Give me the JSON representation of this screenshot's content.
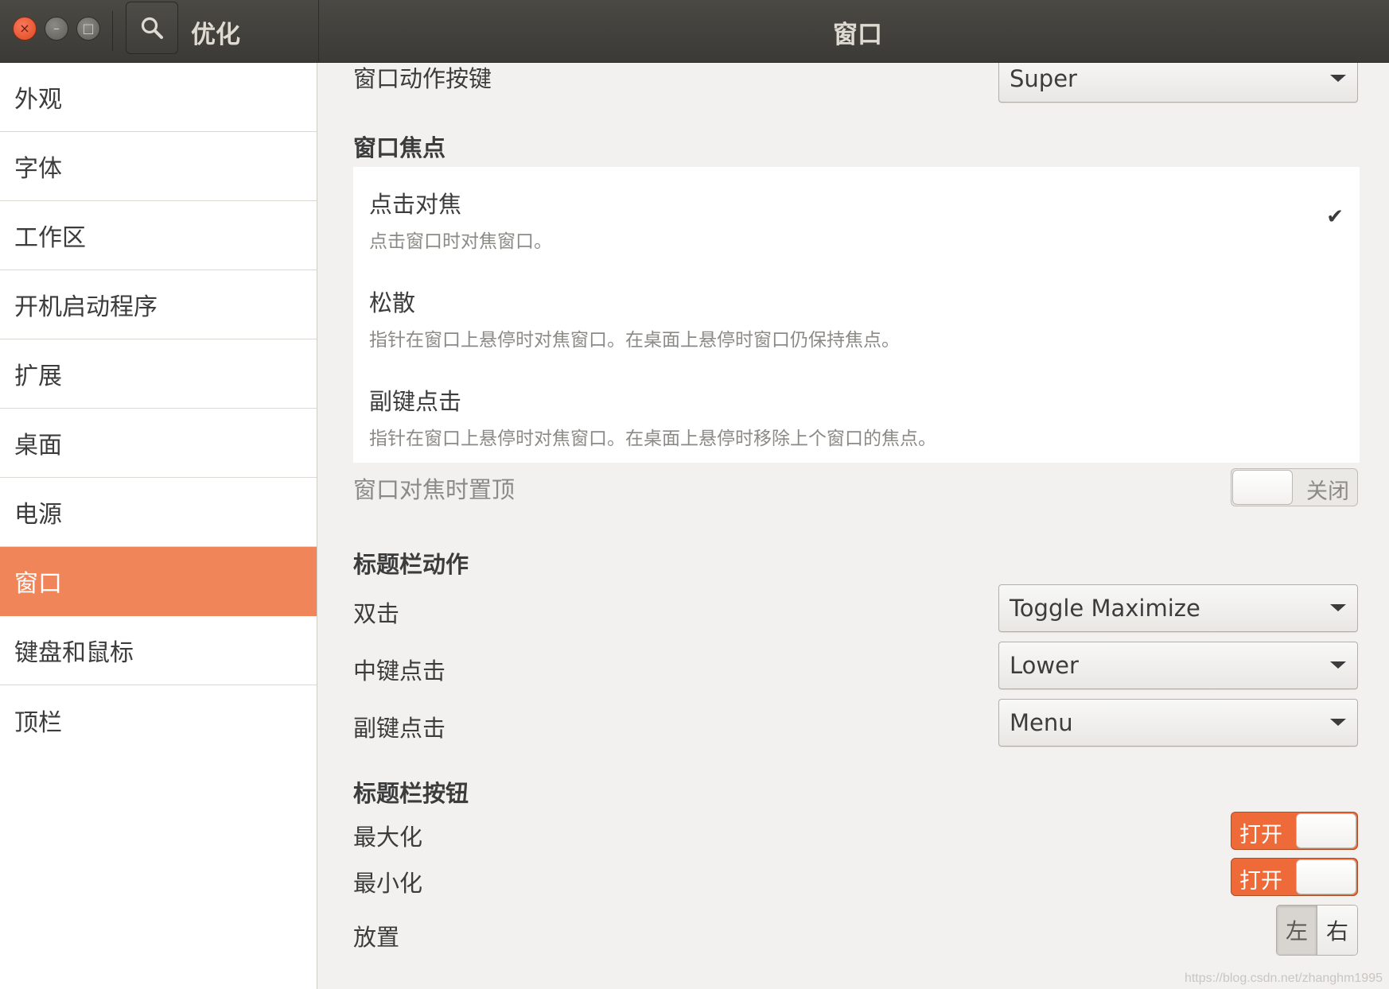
{
  "header": {
    "app_title": "优化",
    "page_title": "窗口",
    "close_glyph": "×",
    "minimize_glyph": "–",
    "maximize_glyph": "□"
  },
  "sidebar": {
    "items": [
      {
        "label": "外观",
        "active": false
      },
      {
        "label": "字体",
        "active": false
      },
      {
        "label": "工作区",
        "active": false
      },
      {
        "label": "开机启动程序",
        "active": false
      },
      {
        "label": "扩展",
        "active": false
      },
      {
        "label": "桌面",
        "active": false
      },
      {
        "label": "电源",
        "active": false
      },
      {
        "label": "窗口",
        "active": true
      },
      {
        "label": "键盘和鼠标",
        "active": false
      },
      {
        "label": "顶栏",
        "active": false
      }
    ]
  },
  "main": {
    "action_key": {
      "label": "窗口动作按键",
      "value": "Super"
    },
    "focus_section_title": "窗口焦点",
    "focus_options": [
      {
        "title": "点击对焦",
        "desc": "点击窗口时对焦窗口。",
        "checked": true
      },
      {
        "title": "松散",
        "desc": "指针在窗口上悬停时对焦窗口。在桌面上悬停时窗口仍保持焦点。",
        "checked": false
      },
      {
        "title": "副键点击",
        "desc": "指针在窗口上悬停时对焦窗口。在桌面上悬停时移除上个窗口的焦点。",
        "checked": false
      }
    ],
    "check_glyph": "✔",
    "raise_on_focus": {
      "label": "窗口对焦时置顶",
      "state": "关闭"
    },
    "titlebar_actions_title": "标题栏动作",
    "titlebar_actions": [
      {
        "label": "双击",
        "value": "Toggle Maximize"
      },
      {
        "label": "中键点击",
        "value": "Lower"
      },
      {
        "label": "副键点击",
        "value": "Menu"
      }
    ],
    "titlebar_buttons_title": "标题栏按钮",
    "maximize": {
      "label": "最大化",
      "state": "打开"
    },
    "minimize": {
      "label": "最小化",
      "state": "打开"
    },
    "placement": {
      "label": "放置",
      "options": [
        "左",
        "右"
      ],
      "selected": "左"
    }
  },
  "watermark": "https://blog.csdn.net/zhanghm1995",
  "colors": {
    "accent": "#f1855a",
    "switch_on": "#ee6a38",
    "headerbar": "#3b3a36",
    "close_button": "#e1481f"
  }
}
